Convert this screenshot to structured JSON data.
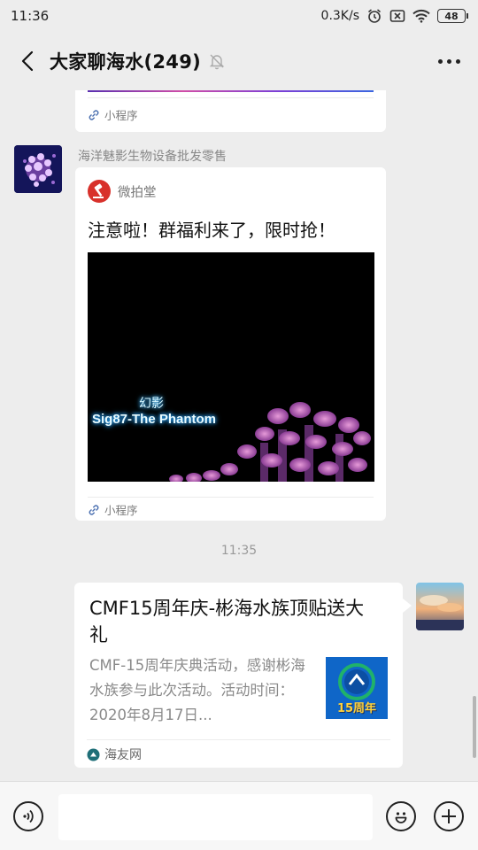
{
  "status_bar": {
    "time": "11:36",
    "net_speed": "0.3K/s",
    "battery": "48",
    "icons": [
      "alarm-icon",
      "sim-off-icon",
      "wifi-icon",
      "battery-icon"
    ]
  },
  "header": {
    "title": "大家聊海水(249)",
    "icons": [
      "back-icon",
      "mute-bell-icon",
      "more-icon"
    ]
  },
  "messages": [
    {
      "type": "mini-program-partial",
      "footer_label": "小程序"
    },
    {
      "type": "mini-program",
      "sender": "海洋魅影生物设备批发零售",
      "app_name": "微拍堂",
      "text": "注意啦！群福利来了，限时抢！",
      "image_caption_cn": "幻影",
      "image_caption_en": "Sig87-The Phantom",
      "footer_label": "小程序"
    },
    {
      "type": "time",
      "time": "11:35"
    },
    {
      "type": "link-card",
      "side": "self",
      "title": "CMF15周年庆-彬海水族顶贴送大礼",
      "description": "CMF-15周年庆典活动，感谢彬海水族参与此次活动。活动时间：2020年8月17日...",
      "thumb_text": "15周年",
      "source": "海友网"
    }
  ],
  "input_bar": {
    "placeholder": "",
    "icons": [
      "voice-icon",
      "emoji-icon",
      "plus-icon"
    ]
  },
  "colors": {
    "background": "#ededed",
    "card": "#ffffff",
    "weipaitang_red": "#d8312b",
    "haiyou_teal": "#1f6f78"
  }
}
